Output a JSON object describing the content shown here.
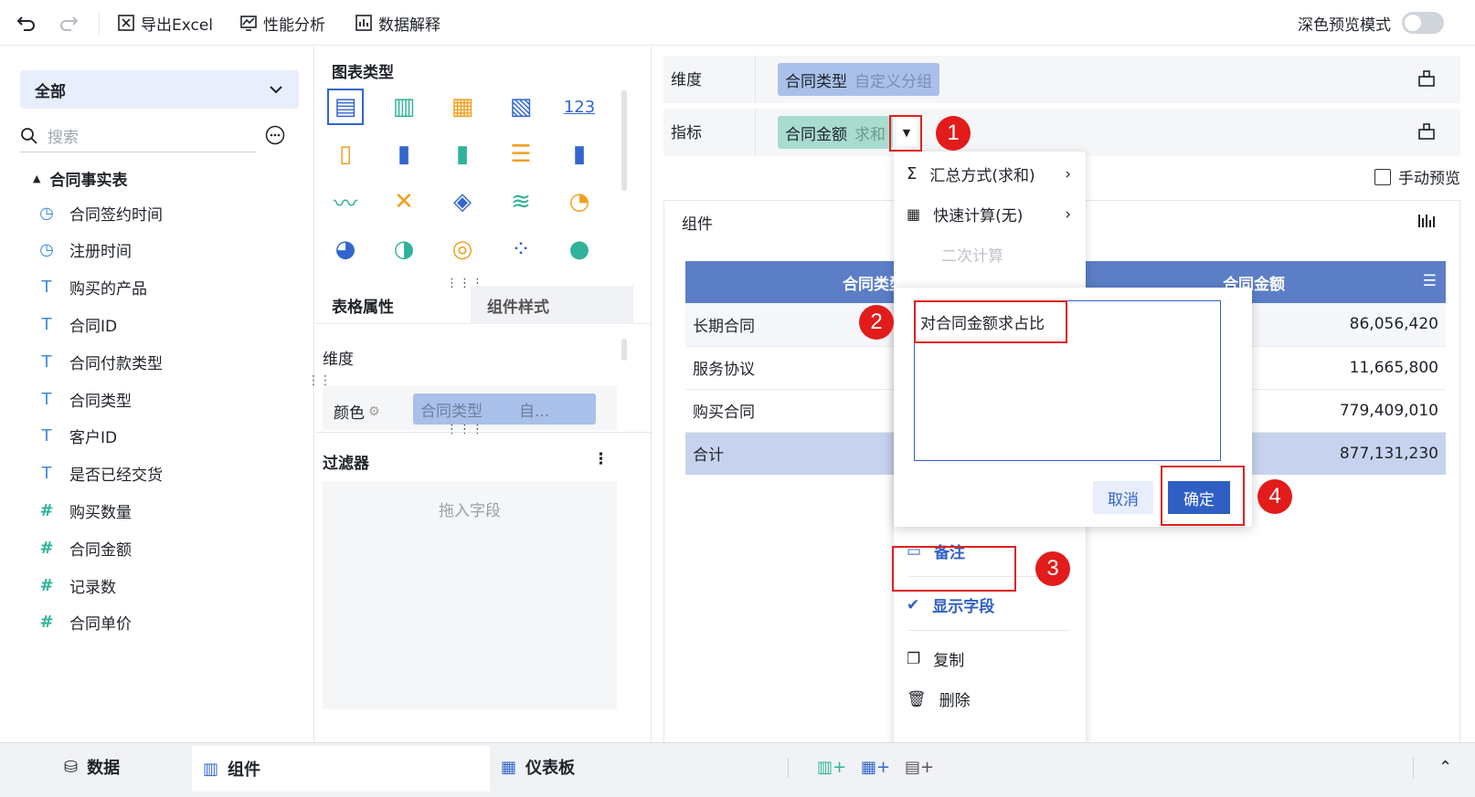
{
  "toolbar": {
    "export_label": "导出Excel",
    "perf_label": "性能分析",
    "explain_label": "数据解释",
    "dark_mode_label": "深色预览模式"
  },
  "left": {
    "dataset": "全部",
    "search_placeholder": "搜索",
    "table_name": "合同事实表",
    "fields": [
      {
        "label": "合同签约时间",
        "icon": "clock-icon"
      },
      {
        "label": "注册时间",
        "icon": "clock-icon"
      },
      {
        "label": "购买的产品",
        "icon": "text-icon"
      },
      {
        "label": "合同ID",
        "icon": "text-icon"
      },
      {
        "label": "合同付款类型",
        "icon": "text-icon"
      },
      {
        "label": "合同类型",
        "icon": "text-icon"
      },
      {
        "label": "客户ID",
        "icon": "text-icon"
      },
      {
        "label": "是否已经交货",
        "icon": "text-icon"
      },
      {
        "label": "购买数量",
        "icon": "number-icon"
      },
      {
        "label": "合同金额",
        "icon": "number-icon"
      },
      {
        "label": "记录数",
        "icon": "number-icon"
      },
      {
        "label": "合同单价",
        "icon": "calc-number-icon"
      }
    ]
  },
  "middle": {
    "chart_type_title": "图表类型",
    "chart_123": "123",
    "tab_table_props": "表格属性",
    "tab_component_style": "组件样式",
    "dimension_label": "维度",
    "color_label": "颜色",
    "color_pill_field": "合同类型",
    "color_pill_suffix": "自...",
    "filter_title": "过滤器",
    "drop_hint": "拖入字段"
  },
  "right": {
    "dimension_label": "维度",
    "dimension_pill_field": "合同类型",
    "dimension_pill_suffix": "自定义分组",
    "metric_label": "指标",
    "metric_pill_field": "合同金额",
    "metric_pill_suffix": "求和",
    "manual_preview": "手动预览",
    "component_label": "组件",
    "table": {
      "headers": [
        "合同类型",
        "合同金额"
      ],
      "rows": [
        [
          "长期合同",
          "86,056,420"
        ],
        [
          "服务协议",
          "11,665,800"
        ],
        [
          "购买合同",
          "779,409,010"
        ]
      ],
      "total": [
        "合计",
        "877,131,230"
      ]
    }
  },
  "menu": {
    "summary": "汇总方式(求和)",
    "quick_calc": "快速计算(无)",
    "secondary_calc": "二次计算",
    "remark": "备注",
    "show_field": "显示字段",
    "copy": "复制",
    "delete": "删除"
  },
  "dialog": {
    "text": "对合同金额求占比",
    "cancel": "取消",
    "confirm": "确定"
  },
  "badges": [
    "1",
    "2",
    "3",
    "4"
  ],
  "bottom": {
    "data_tab": "数据",
    "component_tab": "组件",
    "dashboard_tab": "仪表板"
  },
  "colors": {
    "accent": "#3366cc",
    "table_header": "#5b7ec7",
    "pill_dim": "#a9c0ea",
    "pill_metric": "#a8dcd0",
    "annotation_red": "#e21b1b"
  }
}
